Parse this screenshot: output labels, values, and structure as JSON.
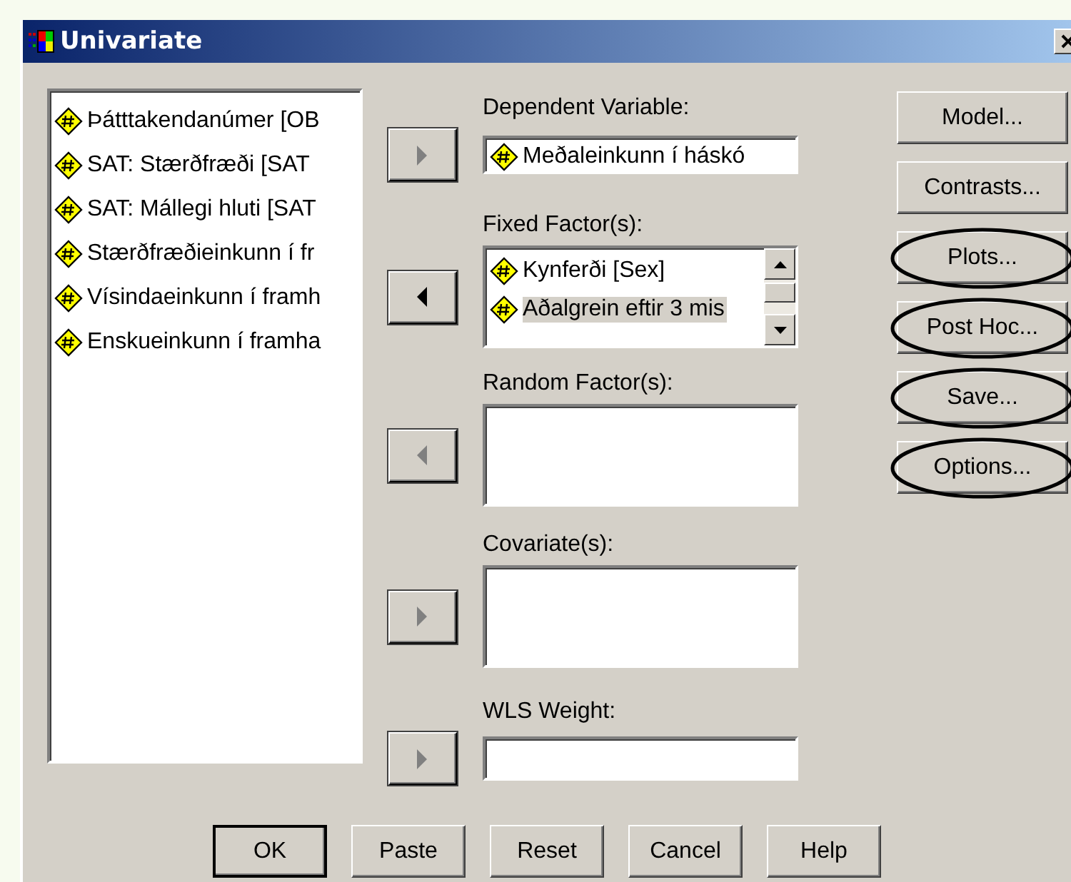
{
  "window": {
    "title": "Univariate"
  },
  "variables": [
    {
      "label": "Þátttakendanúmer [OB"
    },
    {
      "label": "SAT: Stærðfræði [SAT"
    },
    {
      "label": "SAT: Mállegi hluti [SAT"
    },
    {
      "label": "Stærðfræðieinkunn í fr"
    },
    {
      "label": "Vísindaeinkunn í framh"
    },
    {
      "label": "Enskueinkunn í framha"
    }
  ],
  "targets": [
    {
      "kind": "field",
      "label": "Dependent Variable:",
      "arrow": {
        "kind": "right",
        "disabled": true
      },
      "items": [
        {
          "label": "Meðaleinkunn í háskó",
          "selected": false
        }
      ]
    },
    {
      "kind": "list",
      "label": "Fixed Factor(s):",
      "arrow": {
        "kind": "left",
        "disabled": false
      },
      "items": [
        {
          "label": "Kynferði [Sex]",
          "selected": false
        },
        {
          "label": "Aðalgrein eftir 3 mis",
          "selected": true
        }
      ]
    },
    {
      "kind": "box",
      "label": "Random Factor(s):",
      "arrow": {
        "kind": "left",
        "disabled": true
      }
    },
    {
      "kind": "box",
      "label": "Covariate(s):",
      "arrow": {
        "kind": "right",
        "disabled": true
      }
    },
    {
      "kind": "weight",
      "label": "WLS Weight:",
      "arrow": {
        "kind": "right",
        "disabled": true
      }
    }
  ],
  "side_buttons": [
    {
      "label": "Model...",
      "circled": false
    },
    {
      "label": "Contrasts...",
      "circled": false
    },
    {
      "label": "Plots...",
      "circled": true
    },
    {
      "label": "Post Hoc...",
      "circled": true
    },
    {
      "label": "Save...",
      "circled": true
    },
    {
      "label": "Options...",
      "circled": true
    }
  ],
  "buttons": [
    {
      "label": "OK",
      "default": true
    },
    {
      "label": "Paste",
      "default": false
    },
    {
      "label": "Reset",
      "default": false
    },
    {
      "label": "Cancel",
      "default": false
    },
    {
      "label": "Help",
      "default": false
    }
  ]
}
